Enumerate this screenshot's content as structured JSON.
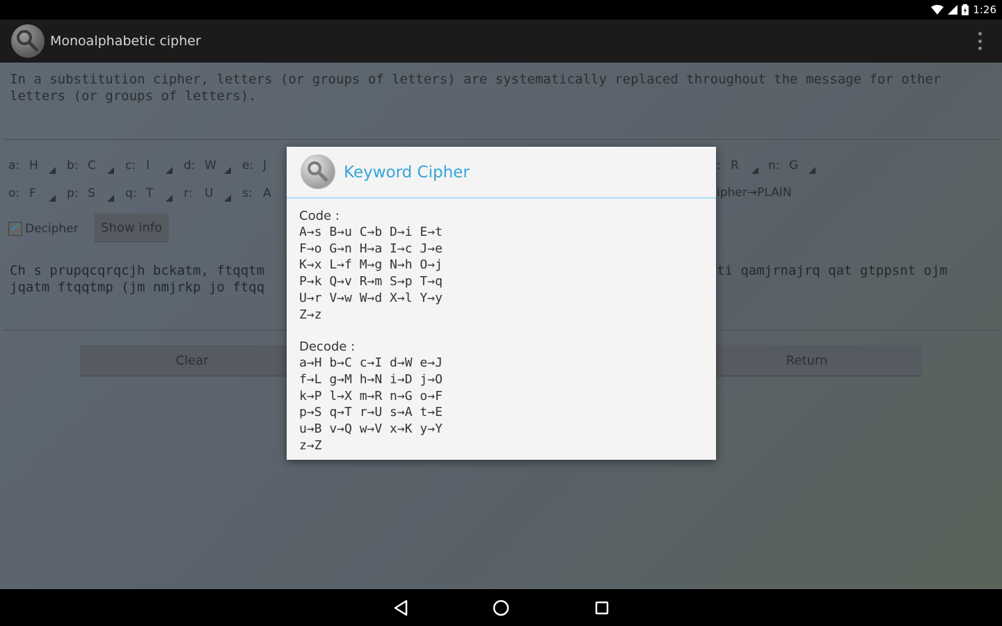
{
  "status": {
    "time": "1:26"
  },
  "app": {
    "title": "Monoalphabetic cipher"
  },
  "intro": "In a substitution cipher, letters (or groups of letters) are systematically replaced throughout the message for other letters (or groups of letters).",
  "key_fields": [
    {
      "label": "a:",
      "value": "H"
    },
    {
      "label": "b:",
      "value": "C"
    },
    {
      "label": "c:",
      "value": "I"
    },
    {
      "label": "d:",
      "value": "W"
    },
    {
      "label": "e:",
      "value": "J"
    },
    {
      "label": "o:",
      "value": "F"
    },
    {
      "label": "p:",
      "value": "S"
    },
    {
      "label": "q:",
      "value": "T"
    },
    {
      "label": "r:",
      "value": "U"
    },
    {
      "label": "s:",
      "value": "A"
    },
    {
      "label": ":",
      "value": "R"
    },
    {
      "label": "n:",
      "value": "G"
    }
  ],
  "mapping_label": "ipher→PLAIN",
  "decipher": {
    "label": "Decipher",
    "checked": true
  },
  "show_info_label": "Show info",
  "ciphertext": {
    "line1_left": "Ch s prupqcqrqcjh bckatm, ftqqtm",
    "line1_right": "ti qamjrnajrq qat gtppsnt ojm",
    "line2_left": "jqatm ftqqtmp (jm nmjrkp jo ftqq"
  },
  "buttons": {
    "clear": "Clear",
    "return": "Return"
  },
  "dialog": {
    "title": "Keyword Cipher",
    "code_heading": "Code :",
    "code_lines": [
      "A→s B→u C→b D→i E→t",
      "F→o G→n H→a I→c J→e",
      "K→x L→f M→g N→h O→j",
      "P→k Q→v R→m S→p T→q",
      "U→r V→w W→d X→l Y→y",
      "Z→z"
    ],
    "decode_heading": "Decode :",
    "decode_lines": [
      "a→H b→C c→I d→W e→J",
      "f→L g→M h→N i→D j→O",
      "k→P l→X m→R n→G o→F",
      "p→S q→T r→U s→A t→E",
      "u→B v→Q w→V x→K y→Y",
      "z→Z"
    ]
  }
}
